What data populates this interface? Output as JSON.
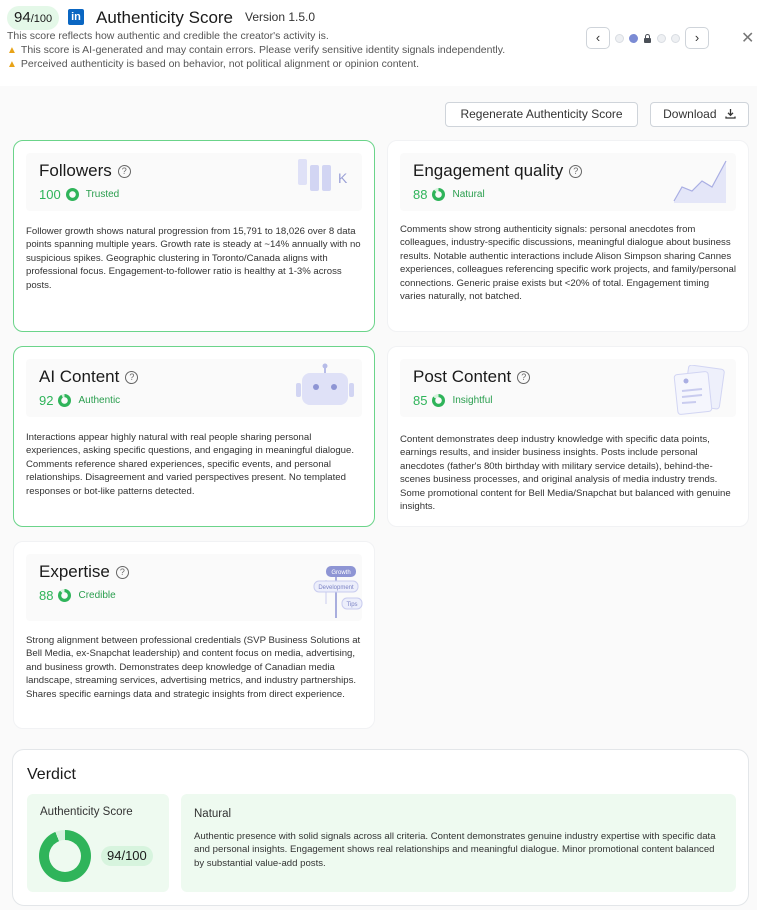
{
  "header": {
    "score_big": "94",
    "score_small": "/100",
    "logo_text": "in",
    "title": "Authenticity Score",
    "version": "Version 1.5.0",
    "subtitle": "This score reflects how authentic and credible the creator's activity is.",
    "warnings": [
      "This score is AI-generated and may contain errors. Please verify sensitive identity signals independently.",
      "Perceived authenticity is based on behavior, not political alignment or opinion content."
    ],
    "warn_icon": "warning-triangle-icon",
    "prev_glyph": "‹",
    "next_glyph": "›",
    "close_glyph": "✕"
  },
  "toolbar": {
    "regenerate_label": "Regenerate Authenticity Score",
    "download_label": "Download",
    "download_icon": "download-icon"
  },
  "cards": {
    "followers": {
      "title": "Followers",
      "score": "100",
      "label": "Trusted",
      "fill": 1.0,
      "illus_text": "K",
      "body": "Follower growth shows natural progression from 15,791 to 18,026 over 8 data points spanning multiple years. Growth rate is steady at ~14% annually with no suspicious spikes. Geographic clustering in Toronto/Canada aligns with professional focus. Engagement-to-follower ratio is healthy at 1-3% across posts."
    },
    "engagement": {
      "title": "Engagement quality",
      "score": "88",
      "label": "Natural",
      "fill": 0.88,
      "body": "Comments show strong authenticity signals: personal anecdotes from colleagues, industry-specific discussions, meaningful dialogue about business results. Notable authentic interactions include Alison Simpson sharing Cannes experiences, colleagues referencing specific work projects, and family/personal connections. Generic praise exists but <20% of total. Engagement timing varies naturally, not batched."
    },
    "ai_content": {
      "title": "AI Content",
      "score": "92",
      "label": "Authentic",
      "fill": 0.92,
      "body": "Interactions appear highly natural with real people sharing personal experiences, asking specific questions, and engaging in meaningful dialogue. Comments reference shared experiences, specific events, and personal relationships. Disagreement and varied perspectives present. No templated responses or bot-like patterns detected."
    },
    "post_content": {
      "title": "Post Content",
      "score": "85",
      "label": "Insightful",
      "fill": 0.85,
      "body": "Content demonstrates deep industry knowledge with specific data points, earnings results, and insider business insights. Posts include personal anecdotes (father's 80th birthday with military service details), behind-the-scenes business processes, and original analysis of media industry trends. Some promotional content for Bell Media/Snapchat but balanced with genuine insights."
    },
    "expertise": {
      "title": "Expertise",
      "score": "88",
      "label": "Credible",
      "fill": 0.88,
      "illus_tags": [
        "Growth",
        "Development",
        "Tips"
      ],
      "body": "Strong alignment between professional credentials (SVP Business Solutions at Bell Media, ex-Snapchat leadership) and content focus on media, advertising, and business growth. Demonstrates deep knowledge of Canadian media landscape, streaming services, advertising metrics, and industry partnerships. Shares specific earnings data and strategic insights from direct experience."
    }
  },
  "verdict": {
    "title": "Verdict",
    "score_label": "Authenticity Score",
    "score_value": "94/100",
    "fill": 0.94,
    "category": "Natural",
    "text": "Authentic presence with solid signals across all criteria. Content demonstrates genuine industry expertise with specific data and personal insights. Engagement shows real relationships and meaningful dialogue. Minor promotional content balanced by substantial value-add posts."
  },
  "colors": {
    "accent_green": "#2fb45a",
    "ring_track": "#d6f2dd",
    "linkedin_blue": "#0a66c2",
    "illus_purple": "#c9ccef"
  }
}
